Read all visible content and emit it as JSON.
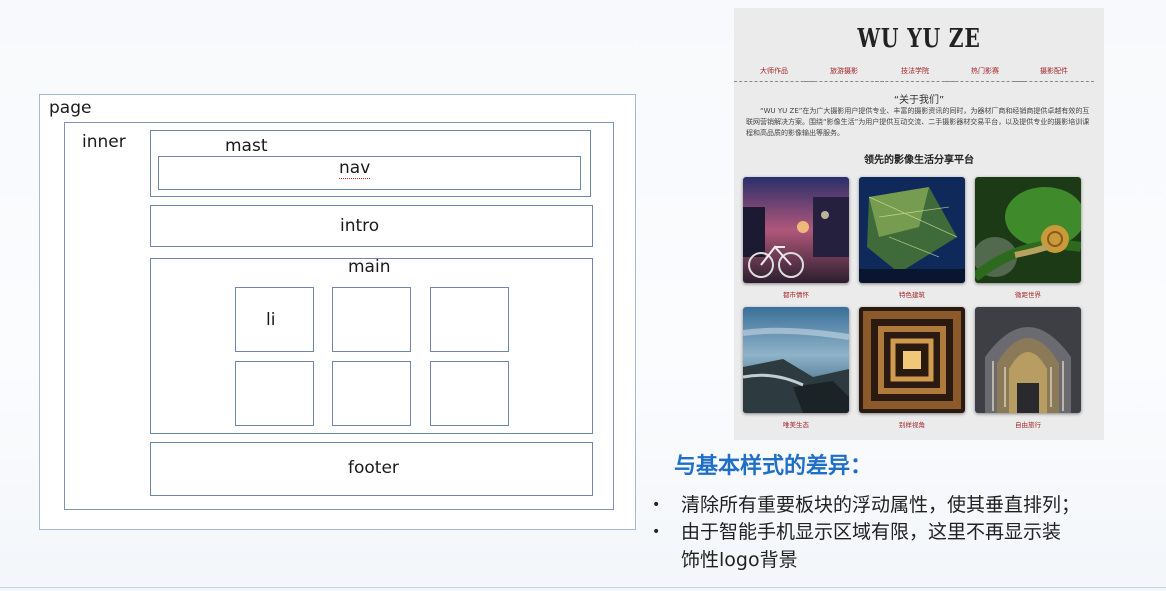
{
  "diagram": {
    "page_label": "page",
    "inner_label": "inner",
    "mast_label": "mast",
    "nav_label": "nav",
    "intro_label": "intro",
    "main_label": "main",
    "li_label": "li",
    "footer_label": "footer"
  },
  "mockup": {
    "logo": "WU YU ZE",
    "nav_items": [
      "大师作品",
      "旅游摄影",
      "技法学院",
      "热门影赛",
      "摄影配件"
    ],
    "about_title": "“关于我们”",
    "about_text": "“WU YU ZE”在为广大摄影用户提供专业、丰富的摄影资讯的同时，为器材厂商和经销商提供卓越有效的互联网营销解决方案。围绕“影像生活”为用户提供互动交流、二手摄影器材交易平台，以及提供专业的摄影培训课程和高品质的影像输出等服务。",
    "tagline": "领先的影像生活分享平台",
    "gallery": [
      {
        "caption": "都市情怀",
        "scene": "city-night-bicycle"
      },
      {
        "caption": "特色建筑",
        "scene": "glass-architecture-night"
      },
      {
        "caption": "微距世界",
        "scene": "snail-macro"
      },
      {
        "caption": "唯美生态",
        "scene": "rocky-coast-sea"
      },
      {
        "caption": "别样视角",
        "scene": "spiral-staircase"
      },
      {
        "caption": "自由旅行",
        "scene": "gothic-cathedral-portal"
      }
    ]
  },
  "text": {
    "heading": "与基本样式的差异：",
    "bullet_char": "•",
    "bullet_1": "清除所有重要板块的浮动属性，使其垂直排列；",
    "bullet_2_line1": "由于智能手机显示区域有限，这里不再显示装",
    "bullet_2_line2": "饰性logo背景"
  }
}
